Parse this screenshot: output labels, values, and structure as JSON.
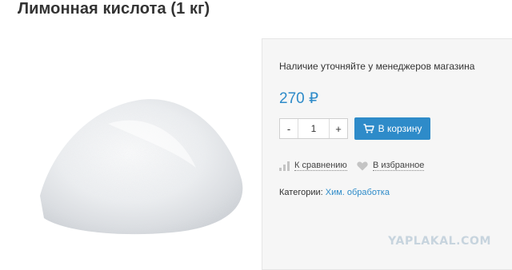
{
  "product": {
    "title": "Лимонная кислота (1 кг)"
  },
  "panel": {
    "availability": "Наличие уточняйте у менеджеров магазина",
    "price": "270 ₽",
    "quantity": {
      "minus": "-",
      "value": "1",
      "plus": "+"
    },
    "cart_button": "В корзину",
    "compare_link": "К сравнению",
    "favorite_link": "В избранное",
    "categories_label": "Категории:",
    "category_link": "Хим. обработка"
  },
  "watermark": "YAPLAKAL.COM",
  "colors": {
    "accent": "#2e8bc9",
    "panel_bg": "#f6f6f6"
  },
  "icons": [
    "cart-icon",
    "compare-chart-icon",
    "heart-icon"
  ]
}
